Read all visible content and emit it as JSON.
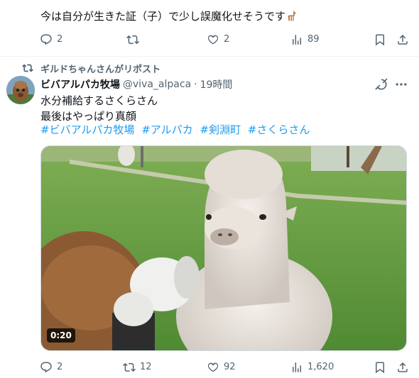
{
  "previous_tweet": {
    "text": "今は自分が生きた証（子）で少し誤魔化せそうです",
    "emoji": "llama-emoji",
    "replies": "2",
    "reposts": "",
    "likes": "2",
    "views": "89"
  },
  "repost_banner": {
    "label": "ギルドちゃんさんがリポスト"
  },
  "tweet": {
    "display_name": "ビバアルパカ牧場",
    "handle": "@viva_alpaca",
    "separator": "·",
    "time": "19時間",
    "lines": [
      "水分補給するさくらさん",
      "最後はやっぱり真顔"
    ],
    "hashtags": [
      "#ビバアルパカ牧場",
      "#アルパカ",
      "#剣淵町",
      "#さくらさん"
    ],
    "video_duration": "0:20",
    "replies": "2",
    "reposts": "12",
    "likes": "92",
    "views": "1,620"
  },
  "colors": {
    "accent": "#1d9bf0",
    "muted": "#536471",
    "text": "#0f1419"
  }
}
